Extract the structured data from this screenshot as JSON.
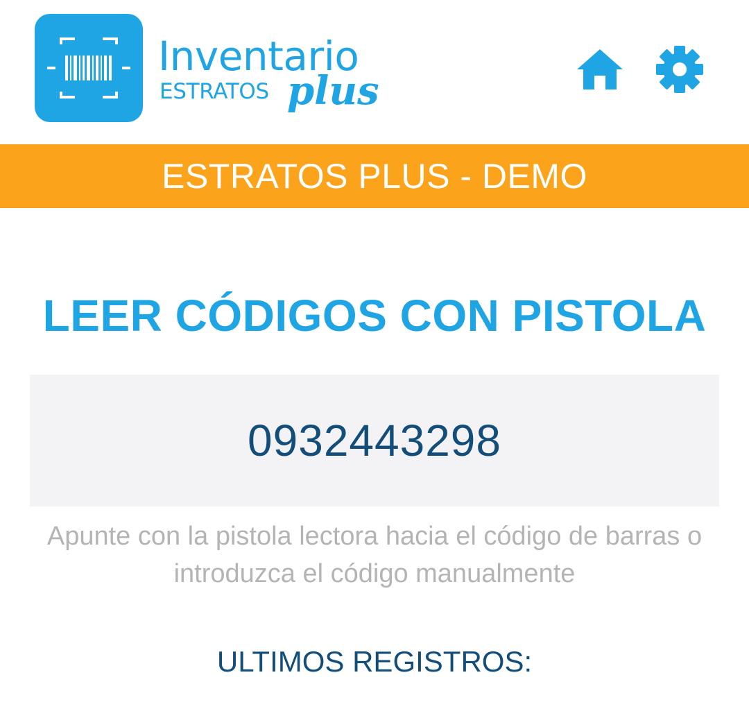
{
  "header": {
    "brand_name": "Inventario",
    "brand_sub": "ESTRATOS",
    "brand_script": "plus",
    "logo_icon": "barcode-scan-icon",
    "home_icon": "home-icon",
    "settings_icon": "gear-icon",
    "accent_color": "#1fa4e4"
  },
  "company_bar": {
    "label": "ESTRATOS PLUS - DEMO",
    "color": "#fca31c"
  },
  "main": {
    "title": "LEER CÓDIGOS CON PISTOLA",
    "code_value": "0932443298",
    "hint": "Apunte con la pistola lectora hacia el código de barras o introduzca el código manualmente",
    "records_title": "ULTIMOS REGISTROS:"
  }
}
